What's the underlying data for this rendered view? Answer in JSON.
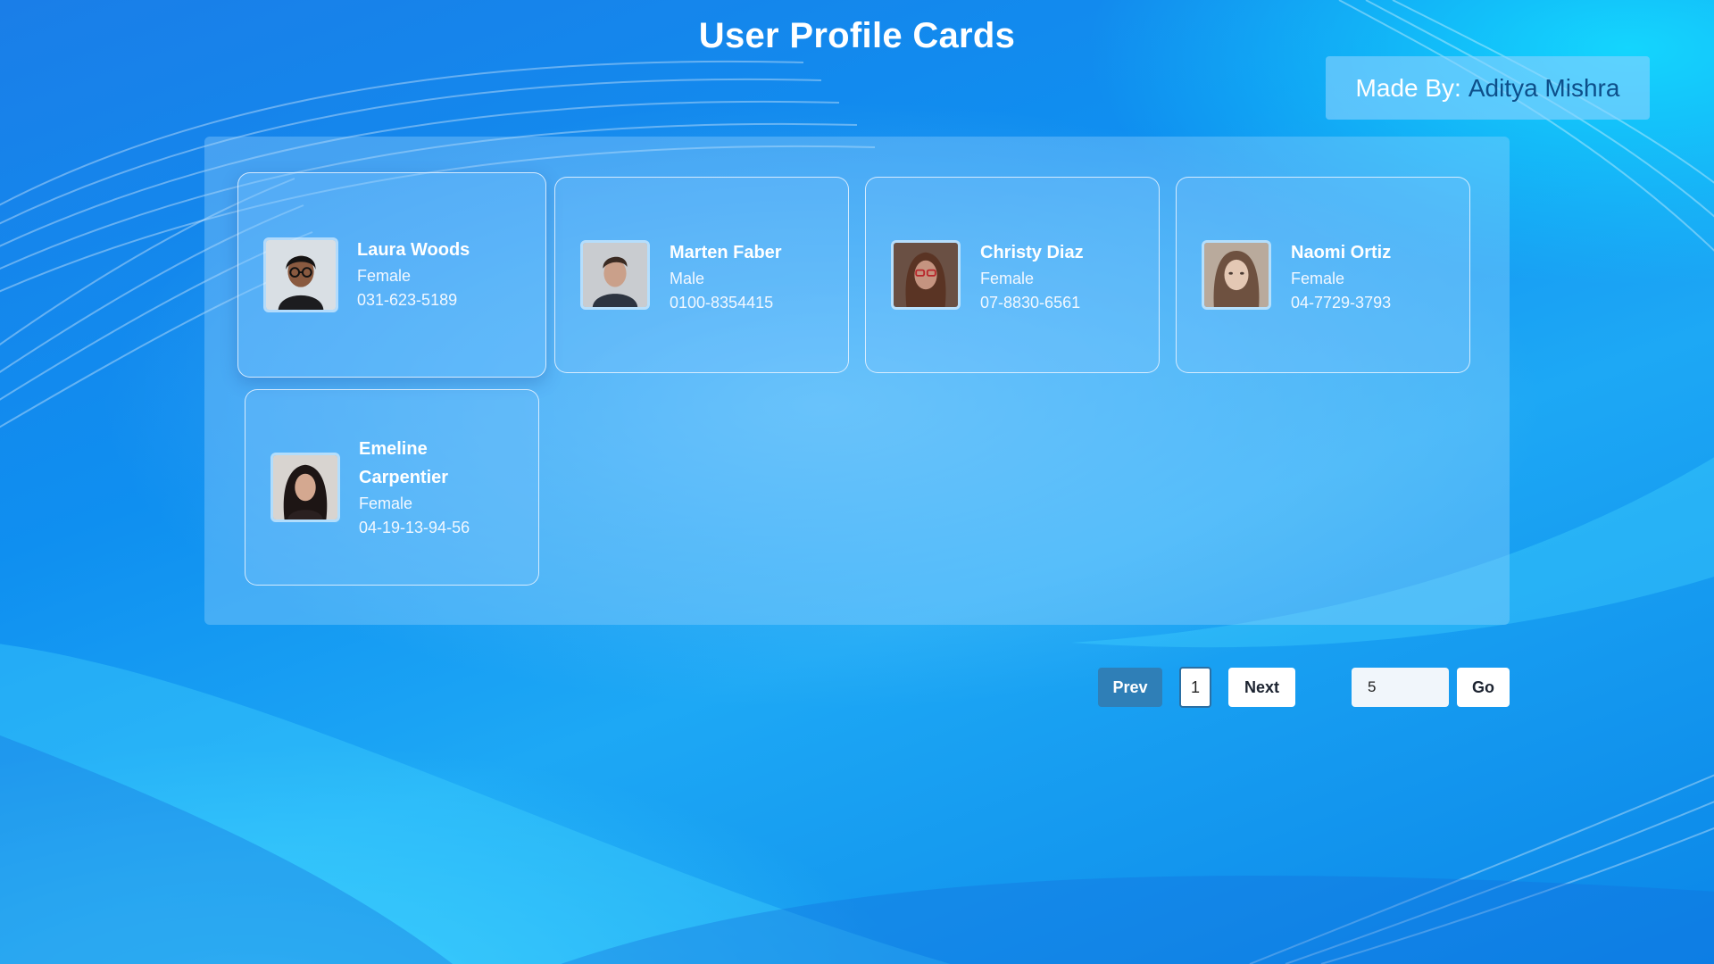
{
  "page": {
    "title": "User Profile Cards"
  },
  "made_by": {
    "label": "Made By:",
    "author": "Aditya Mishra"
  },
  "cards": [
    {
      "name": "Laura Woods",
      "gender": "Female",
      "phone": "031-623-5189",
      "avatar": "avatar-photo-woman-glasses"
    },
    {
      "name": "Marten Faber",
      "gender": "Male",
      "phone": "0100-8354415",
      "avatar": "avatar-photo-man"
    },
    {
      "name": "Christy Diaz",
      "gender": "Female",
      "phone": "07-8830-6561",
      "avatar": "avatar-photo-woman-red-glasses"
    },
    {
      "name": "Naomi Ortiz",
      "gender": "Female",
      "phone": "04-7729-3793",
      "avatar": "avatar-photo-woman"
    },
    {
      "name_line1": "Emeline",
      "name_line2": "Carpentier",
      "gender": "Female",
      "phone": "04-19-13-94-56",
      "avatar": "avatar-photo-woman-dark-hair"
    }
  ],
  "pagination": {
    "prev_label": "Prev",
    "current_page": "1",
    "next_label": "Next",
    "go_input_value": "5",
    "go_label": "Go"
  },
  "colors": {
    "prev_button": "#2f7fb7",
    "card_border": "#ebf5ff"
  }
}
